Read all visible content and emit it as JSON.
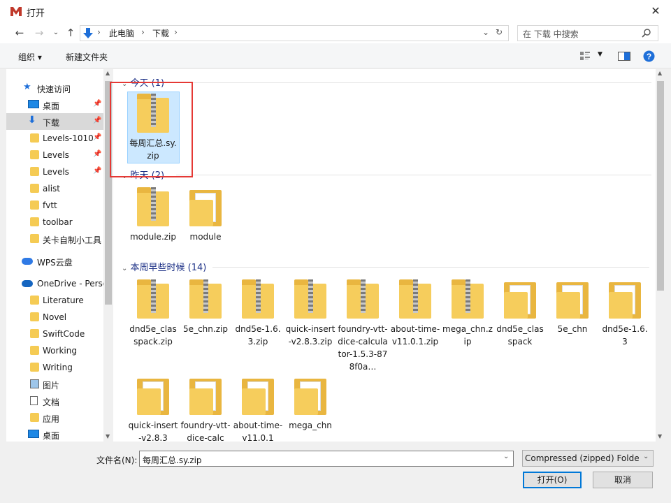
{
  "window": {
    "title": "打开"
  },
  "address": {
    "segments": [
      "此电脑",
      "下载"
    ]
  },
  "search": {
    "placeholder": "在 下载 中搜索"
  },
  "toolbar": {
    "organize": "组织 ▾",
    "new_folder": "新建文件夹"
  },
  "sidebar": {
    "items": [
      {
        "label": "快速访问",
        "icon": "star-icon"
      },
      {
        "label": "桌面",
        "icon": "desktop-icon",
        "pinned": true
      },
      {
        "label": "下载",
        "icon": "download-icon",
        "pinned": true,
        "selected": true
      },
      {
        "label": "Levels-1010",
        "icon": "folder-icon",
        "pinned": true
      },
      {
        "label": "Levels",
        "icon": "folder-icon",
        "pinned": true
      },
      {
        "label": "Levels",
        "icon": "folder-icon",
        "pinned": true
      },
      {
        "label": "alist",
        "icon": "folder-icon"
      },
      {
        "label": "fvtt",
        "icon": "folder-icon"
      },
      {
        "label": "toolbar",
        "icon": "folder-icon"
      },
      {
        "label": "关卡自制小工具",
        "icon": "folder-icon"
      },
      {
        "label": "WPS云盘",
        "icon": "cloud-icon"
      },
      {
        "label": "OneDrive - Perso",
        "icon": "onedrive-icon"
      },
      {
        "label": "Literature",
        "icon": "folder-icon"
      },
      {
        "label": "Novel",
        "icon": "folder-icon"
      },
      {
        "label": "SwiftCode",
        "icon": "folder-icon"
      },
      {
        "label": "Working",
        "icon": "folder-icon"
      },
      {
        "label": "Writing",
        "icon": "folder-icon"
      },
      {
        "label": "图片",
        "icon": "pictures-icon"
      },
      {
        "label": "文档",
        "icon": "documents-icon"
      },
      {
        "label": "应用",
        "icon": "folder-icon"
      },
      {
        "label": "桌面",
        "icon": "desktop-icon"
      }
    ]
  },
  "groups": [
    {
      "label": "今天 (1)",
      "files": [
        {
          "name": "每周汇总.sy.zip",
          "type": "zip"
        }
      ]
    },
    {
      "label": "昨天 (2)",
      "files": [
        {
          "name": "module.zip",
          "type": "zip"
        },
        {
          "name": "module",
          "type": "folder"
        }
      ]
    },
    {
      "label": "本周早些时候 (14)",
      "files": [
        {
          "name": "dnd5e_classpack.zip",
          "type": "zip"
        },
        {
          "name": "5e_chn.zip",
          "type": "zip"
        },
        {
          "name": "dnd5e-1.6.3.zip",
          "type": "zip"
        },
        {
          "name": "quick-insert-v2.8.3.zip",
          "type": "zip"
        },
        {
          "name": "foundry-vtt-dice-calculator-1.5.3-878f0a…",
          "type": "zip"
        },
        {
          "name": "about-time-v11.0.1.zip",
          "type": "zip"
        },
        {
          "name": "mega_chn.zip",
          "type": "zip"
        },
        {
          "name": "dnd5e_classpack",
          "type": "folder"
        },
        {
          "name": "5e_chn",
          "type": "folder"
        },
        {
          "name": "dnd5e-1.6.3",
          "type": "folder"
        },
        {
          "name": "quick-insert-v2.8.3",
          "type": "folder"
        },
        {
          "name": "foundry-vtt-dice-calc",
          "type": "folder"
        },
        {
          "name": "about-time-v11.0.1",
          "type": "folder"
        },
        {
          "name": "mega_chn",
          "type": "folder"
        }
      ]
    }
  ],
  "footer": {
    "filename_label": "文件名(N):",
    "filename_value": "每周汇总.sy.zip",
    "filter_value": "Compressed (zipped) Folder",
    "open_label": "打开(O)",
    "cancel_label": "取消"
  },
  "colors": {
    "accent": "#0078d7",
    "highlight": "#e53935",
    "selection": "#cce8ff"
  }
}
